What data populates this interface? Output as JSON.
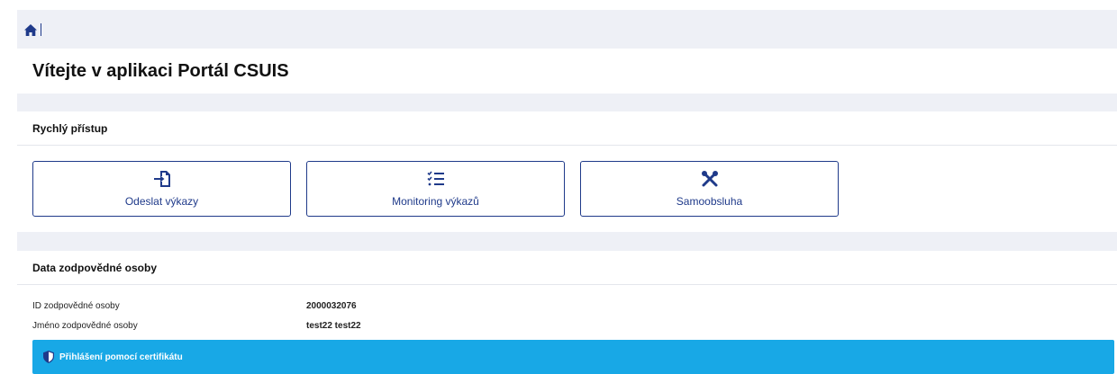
{
  "breadcrumb": {
    "home_icon": "home-icon"
  },
  "page": {
    "title": "Vítejte v aplikaci Portál CSUIS"
  },
  "quick_access": {
    "header": "Rychlý přístup",
    "tiles": [
      {
        "label": "Odeslat výkazy",
        "icon": "document-send-icon"
      },
      {
        "label": "Monitoring výkazů",
        "icon": "checklist-icon"
      },
      {
        "label": "Samoobsluha",
        "icon": "tools-icon"
      }
    ]
  },
  "responsible_person": {
    "header": "Data zodpovědné osoby",
    "rows": [
      {
        "label": "ID zodpovědné osoby",
        "value": "2000032076"
      },
      {
        "label": "Jméno zodpovědné osoby",
        "value": "test22 test22"
      }
    ]
  },
  "certificate": {
    "label": "Přihlášení pomocí certifikátu",
    "icon": "shield-icon"
  },
  "colors": {
    "primary": "#1f3a8a",
    "info": "#18a8e6",
    "background": "#eef0f6"
  }
}
